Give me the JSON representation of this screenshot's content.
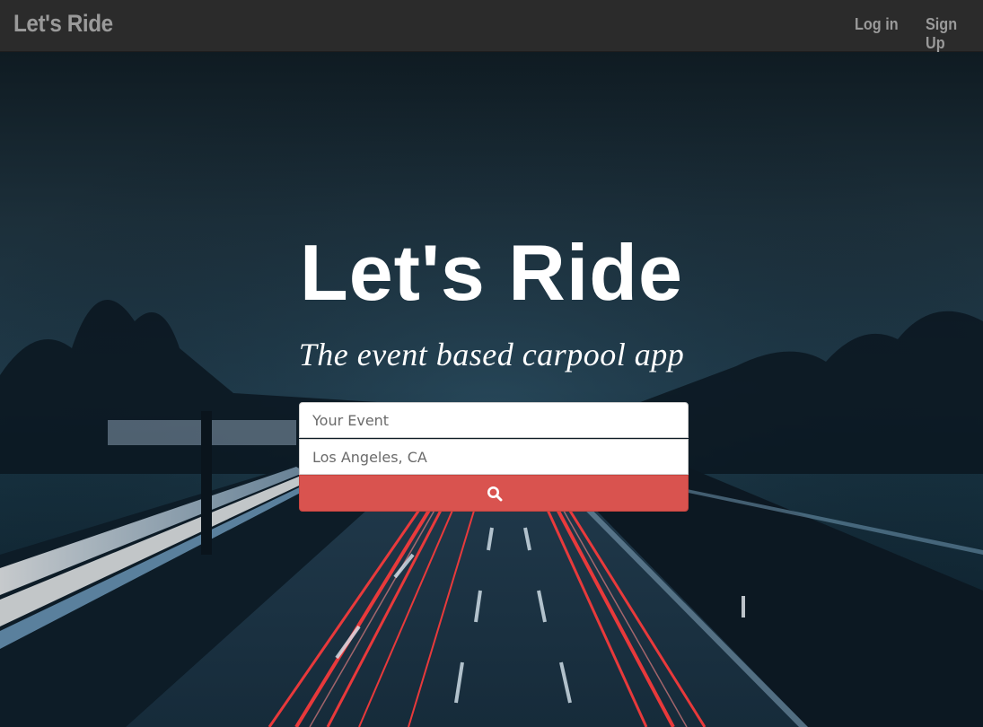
{
  "navbar": {
    "brand": "Let's Ride",
    "login_label": "Log in",
    "signup_label": "Sign Up"
  },
  "hero": {
    "title": "Let's Ride",
    "subtitle": "The event based carpool app",
    "background_description_icon": "night-highway-light-trails-image"
  },
  "search": {
    "event_placeholder": "Your Event",
    "location_value": "Los Angeles, CA",
    "button_icon": "search-icon"
  },
  "colors": {
    "navbar_bg": "#2b2b2b",
    "nav_text": "#9a9a9a",
    "button_red": "#d9534f",
    "hero_text": "#ffffff"
  }
}
